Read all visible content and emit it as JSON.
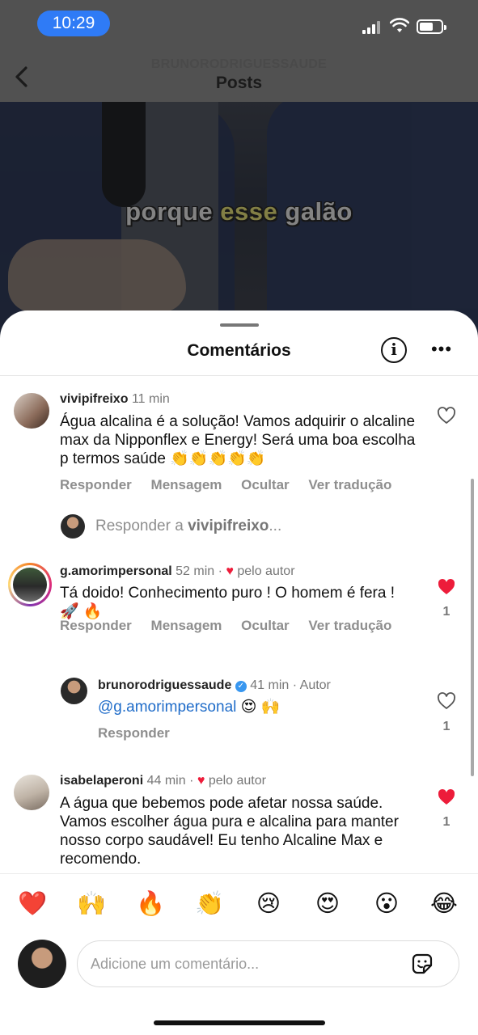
{
  "status_bar": {
    "time": "10:29"
  },
  "header": {
    "username": "BRUNORODRIGUESSAUDE",
    "title": "Posts"
  },
  "video": {
    "caption_before": "porque ",
    "caption_highlight": "esse",
    "caption_after": " galão"
  },
  "sheet": {
    "title": "Comentários",
    "info_icon": "i",
    "more_icon": "•••"
  },
  "comments": [
    {
      "user": "vivipifreixo",
      "time": "11 min",
      "text": "Água alcalina é a solução! Vamos adquirir o alcaline max da Nipponflex e Energy! Será uma boa escolha p termos saúde 👏👏👏👏👏",
      "actions": [
        "Responder",
        "Mensagem",
        "Ocultar",
        "Ver tradução"
      ],
      "liked": false,
      "like_count": ""
    },
    {
      "user": "g.amorimpersonal",
      "time": "52 min",
      "author_badge": "pelo autor",
      "text": "Tá doido! Conhecimento puro ! O homem é fera ! 🚀 🔥",
      "actions": [
        "Responder",
        "Mensagem",
        "Ocultar",
        "Ver tradução"
      ],
      "liked": true,
      "like_count": "1"
    },
    {
      "user": "brunorodriguessaude",
      "time": "41 min",
      "author_label": "Autor",
      "mention": "@g.amorimpersonal",
      "text": " 😍 🙌",
      "actions": [
        "Responder"
      ],
      "liked": false,
      "like_count": "1"
    },
    {
      "user": "isabelaperoni",
      "time": "44 min",
      "author_badge": "pelo autor",
      "text": "A água que bebemos pode afetar nossa saúde. Vamos escolher água pura e alcalina para manter nosso corpo saudável! Eu tenho Alcaline Max e recomendo.",
      "liked": true,
      "like_count": "1"
    }
  ],
  "reply_prompt": {
    "prefix": "Responder a ",
    "user": "vivipifreixo",
    "suffix": "..."
  },
  "emoji_bar": [
    "❤️",
    "🙌",
    "🔥",
    "👏",
    "😢",
    "😍",
    "😮",
    "😂"
  ],
  "input": {
    "placeholder": "Adicione um comentário..."
  },
  "colors": {
    "like_red": "#ed1c3a",
    "mention_blue": "#1f6cc9",
    "status_pill": "#2f7bf6"
  }
}
